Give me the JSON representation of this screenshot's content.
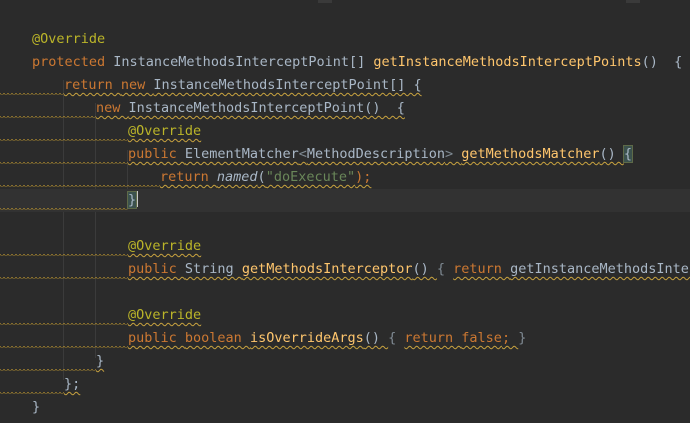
{
  "editor": {
    "lines": [
      {
        "segments": [
          {
            "text": "@Override",
            "cls": "ann"
          }
        ]
      },
      {
        "segments": [
          {
            "text": "protected ",
            "cls": "kw"
          },
          {
            "text": "InstanceMethodsInterceptPoint[] ",
            "cls": ""
          },
          {
            "text": "getInstanceMethodsInterceptPoints",
            "cls": "fn"
          },
          {
            "text": "()  {",
            "cls": ""
          }
        ]
      },
      {
        "segments": [
          {
            "text": "return ",
            "cls": "kw wavy"
          },
          {
            "text": "new ",
            "cls": "kw wavy"
          },
          {
            "text": "InstanceMethodsInterceptPoint[] {",
            "cls": "wavy"
          }
        ]
      },
      {
        "segments": [
          {
            "text": "new ",
            "cls": "kw wavy"
          },
          {
            "text": "InstanceMethodsInterceptPoint()  {",
            "cls": "wavy"
          }
        ]
      },
      {
        "segments": [
          {
            "text": "@Override",
            "cls": "ann wavy"
          }
        ]
      },
      {
        "segments": [
          {
            "text": "public ",
            "cls": "kw wavy"
          },
          {
            "text": "ElementMatcher",
            "cls": "wavy"
          },
          {
            "text": "<",
            "cls": "muted wavy"
          },
          {
            "text": "MethodDescription",
            "cls": "wavy"
          },
          {
            "text": "> ",
            "cls": "muted wavy"
          },
          {
            "text": "getMethodsMatcher",
            "cls": "fn wavy"
          },
          {
            "text": "() ",
            "cls": "wavy"
          },
          {
            "text": "{",
            "cls": "brace-hl"
          }
        ]
      },
      {
        "segments": [
          {
            "text": "return ",
            "cls": "kw wavy"
          },
          {
            "text": "named",
            "cls": "it wavy"
          },
          {
            "text": "(",
            "cls": "wavy"
          },
          {
            "text": "\"doExecute\"",
            "cls": "str wavy"
          },
          {
            "text": ");",
            "cls": "kw wavy"
          }
        ]
      },
      {
        "segments": [
          {
            "text": "}",
            "cls": "brace-hl"
          }
        ],
        "caret": true
      },
      {
        "segments": []
      },
      {
        "segments": [
          {
            "text": "@Override",
            "cls": "ann wavy"
          }
        ]
      },
      {
        "segments": [
          {
            "text": "public ",
            "cls": "kw wavy"
          },
          {
            "text": "String ",
            "cls": "wavy"
          },
          {
            "text": "getMethodsInterceptor",
            "cls": "fn wavy"
          },
          {
            "text": "() ",
            "cls": "wavy"
          },
          {
            "text": "{ ",
            "cls": "muted"
          },
          {
            "text": "return ",
            "cls": "kw wavy"
          },
          {
            "text": "getInstanceMethodsInterce",
            "cls": "wavy"
          }
        ]
      },
      {
        "segments": []
      },
      {
        "segments": [
          {
            "text": "@Override",
            "cls": "ann wavy"
          }
        ]
      },
      {
        "segments": [
          {
            "text": "public ",
            "cls": "kw wavy"
          },
          {
            "text": "boolean ",
            "cls": "kw wavy"
          },
          {
            "text": "isOverrideArgs",
            "cls": "fn wavy"
          },
          {
            "text": "() ",
            "cls": "wavy"
          },
          {
            "text": "{ ",
            "cls": "muted"
          },
          {
            "text": "return ",
            "cls": "kw wavy"
          },
          {
            "text": "false",
            "cls": "kw wavy"
          },
          {
            "text": "; ",
            "cls": "kw wavy"
          },
          {
            "text": "}",
            "cls": "muted"
          }
        ]
      },
      {
        "segments": [
          {
            "text": "}",
            "cls": "wavy"
          }
        ]
      },
      {
        "segments": [
          {
            "text": "};",
            "cls": "wavy"
          }
        ]
      },
      {
        "segments": [
          {
            "text": "}",
            "cls": ""
          }
        ]
      }
    ]
  },
  "colors": {
    "background": "#2b2b2b",
    "caret_line": "#323232",
    "annotation": "#bbb529",
    "keyword": "#cc7832",
    "method": "#ffc66d",
    "string": "#6a8759",
    "default_text": "#a9b7c6",
    "warning_underline": "#c9a33f"
  }
}
